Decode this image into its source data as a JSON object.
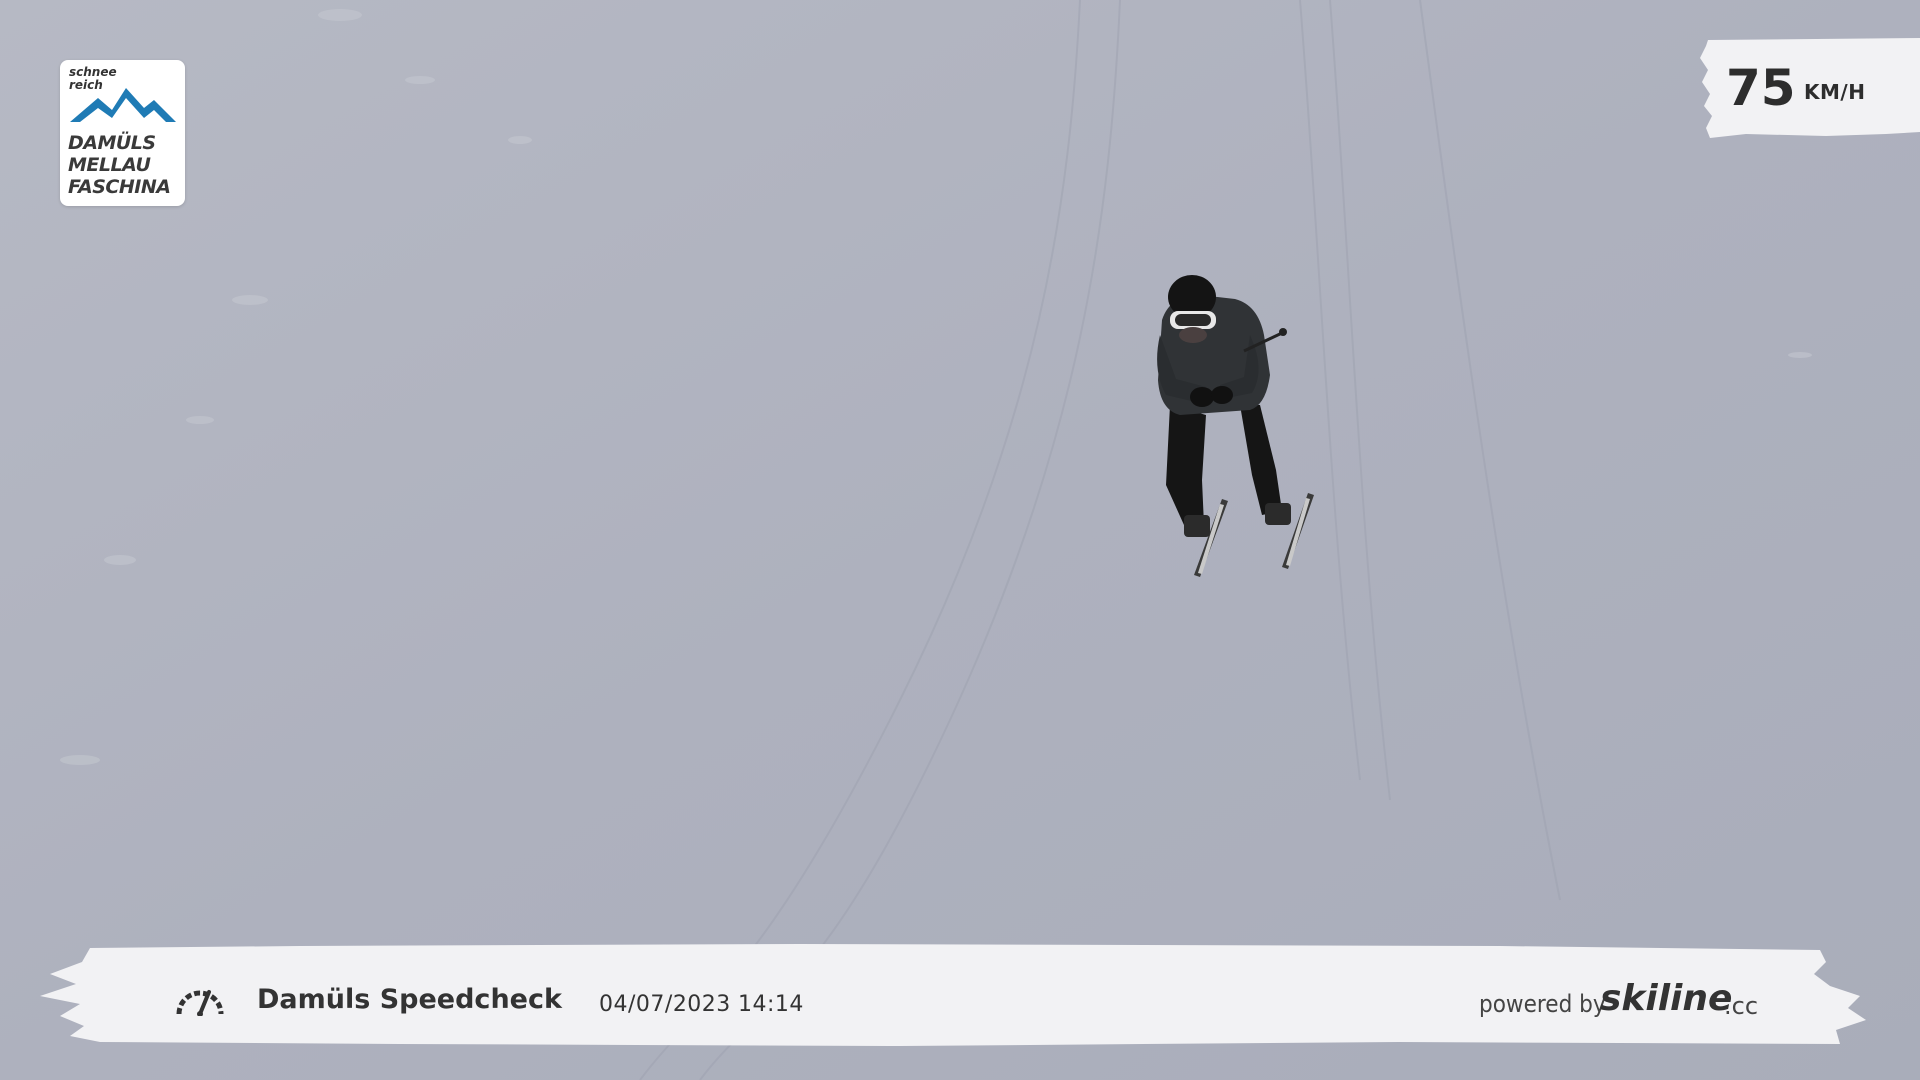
{
  "logo": {
    "tagline_1": "schnee",
    "tagline_2": "reich",
    "names": [
      "DAMÜLS",
      "MELLAU",
      "FASCHINA"
    ],
    "mountain_color": "#1f7bb5"
  },
  "speed": {
    "value": "75",
    "unit": "KM/H"
  },
  "bottom_bar": {
    "icon": "speedometer-icon",
    "title": "Damüls Speedcheck",
    "date": "04/07/2023",
    "time": "14:14",
    "powered_by": "powered by",
    "brand": "skiline",
    "brand_tld": ".cc"
  },
  "colors": {
    "snow": "#acb0bd",
    "panel": "#f2f2f4",
    "text": "#333333"
  }
}
